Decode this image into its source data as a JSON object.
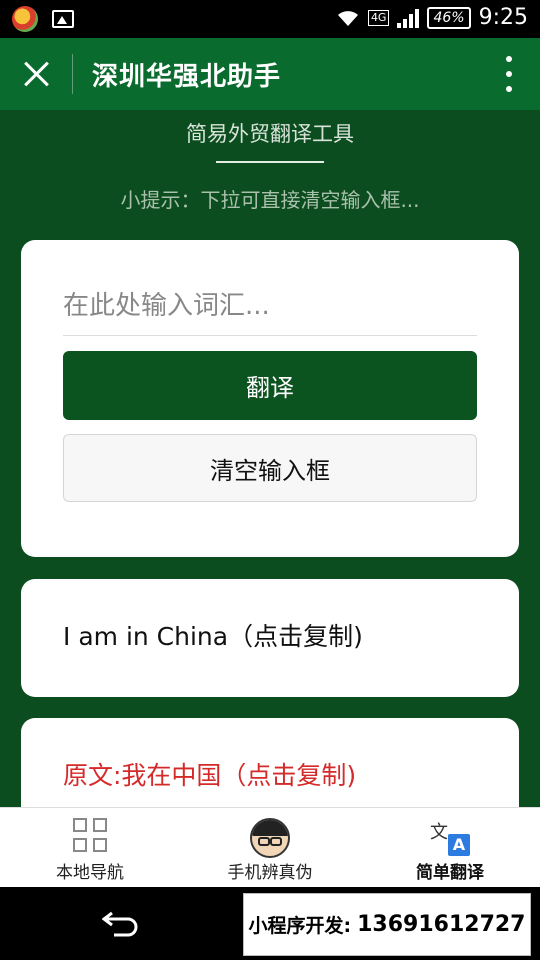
{
  "status_bar": {
    "network": "4G",
    "battery": "46%",
    "time": "9:25"
  },
  "header": {
    "title": "深圳华强北助手"
  },
  "main": {
    "subtitle": "简易外贸翻译工具",
    "tip": "小提示：下拉可直接清空输入框...",
    "input_placeholder": "在此处输入词汇...",
    "translate_button": "翻译",
    "clear_button": "清空输入框",
    "result_text": "I am in China（点击复制)",
    "original_text": "原文:我在中国（点击复制)"
  },
  "tabs": [
    {
      "label": "本地导航",
      "icon": "grid-icon"
    },
    {
      "label": "手机辨真伪",
      "icon": "face-icon"
    },
    {
      "label": "简单翻译",
      "icon": "translate-icon",
      "active": true
    }
  ],
  "promo": {
    "label": "小程序开发:",
    "phone": "13691612727"
  },
  "colors": {
    "header_green": "#0a6b2e",
    "background_green": "#0b4d1e",
    "button_green": "#0b531f",
    "original_red": "#d42a2a"
  }
}
